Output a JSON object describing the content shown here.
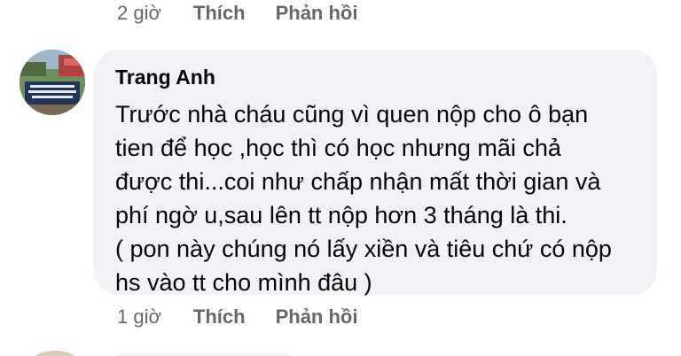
{
  "previous_comment": {
    "time": "2 giờ",
    "like_label": "Thích",
    "reply_label": "Phản hồi"
  },
  "comment": {
    "author": "Trang Anh",
    "lines": [
      "Trước nhà cháu cũng vì quen nộp cho ô bạn",
      "tien để học ,học thì có học nhưng mãi chả",
      "được thi...coi như chấp nhận mất thời gian và",
      "phí ngờ u,sau lên tt nộp hơn 3 tháng là thi.",
      "( pon này chúng nó lấy xiền và tiêu chứ có nộp",
      "hs vào tt cho mình đâu )"
    ],
    "time": "1 giờ",
    "like_label": "Thích",
    "reply_label": "Phản hồi"
  },
  "colors": {
    "bubble_bg": "#f0f2f5",
    "meta_text": "#65676b",
    "body_text": "#050505"
  }
}
